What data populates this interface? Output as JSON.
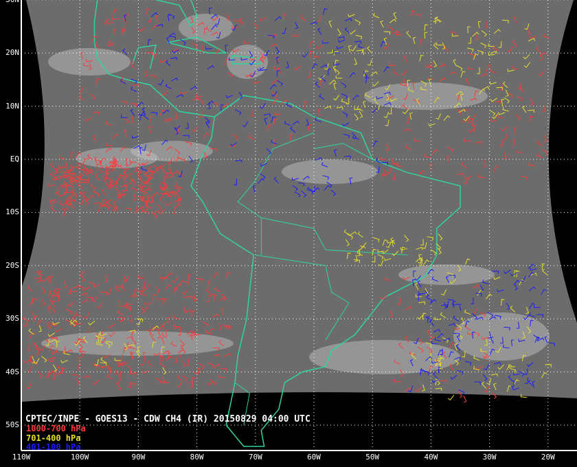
{
  "title": "CPTEC/INPE - GOES13 - CDW CH4 (IR) 20150829 04:00 UTC",
  "legend": [
    {
      "label": "1000-700 hPa",
      "color": "#ff3a3a"
    },
    {
      "label": "701-400 hPa",
      "color": "#e6e02a"
    },
    {
      "label": "401-100 hPa",
      "color": "#1c1cff"
    }
  ],
  "lat_labels": [
    "30N",
    "20N",
    "10N",
    "EQ",
    "10S",
    "20S",
    "30S",
    "40S",
    "50S"
  ],
  "lon_labels": [
    "110W",
    "100W",
    "90W",
    "80W",
    "70W",
    "60W",
    "50W",
    "40W",
    "30W",
    "20W"
  ],
  "colors": {
    "coast": "#2fd59c",
    "grid": "#ffffff",
    "cloud_bg": "#6c6c6c"
  }
}
